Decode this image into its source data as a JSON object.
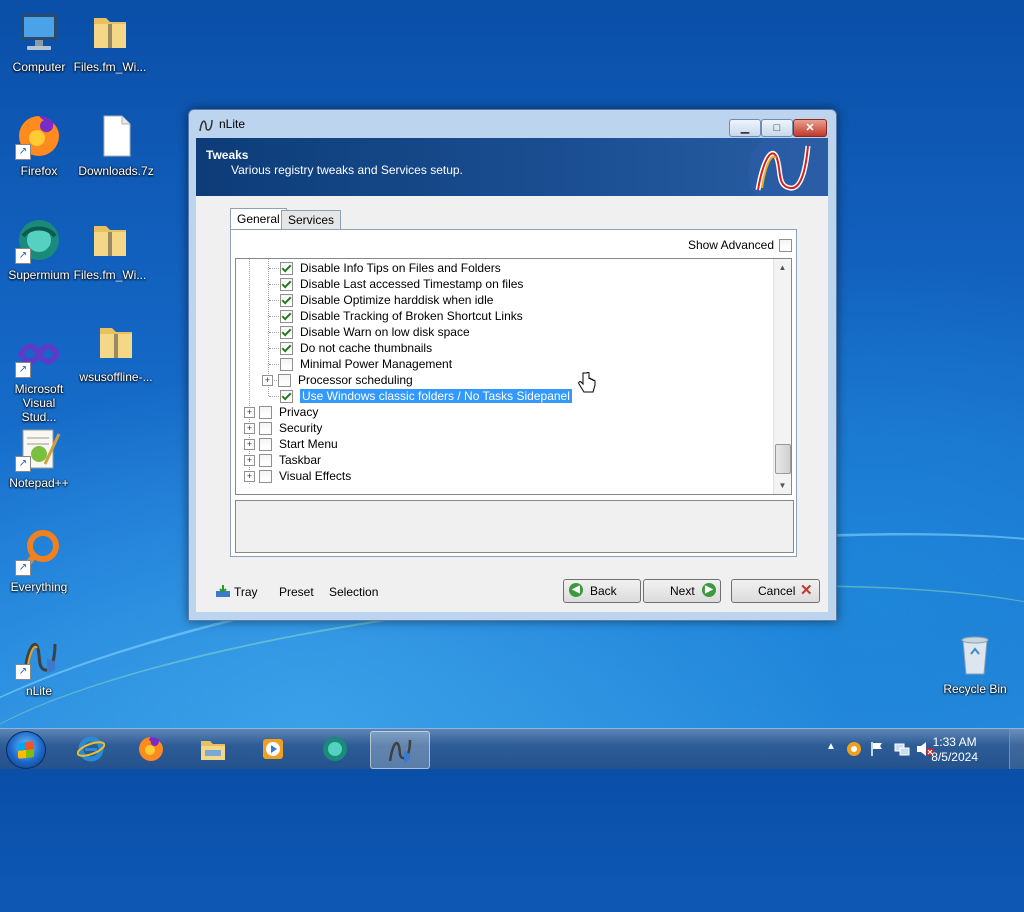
{
  "desktop": {
    "icons": [
      {
        "label": "Computer"
      },
      {
        "label": "Files.fm_Wi..."
      },
      {
        "label": "Firefox"
      },
      {
        "label": "Downloads.7z"
      },
      {
        "label": "Supermium"
      },
      {
        "label": "Files.fm_Wi..."
      },
      {
        "label": "Microsoft Visual Stud..."
      },
      {
        "label": "wsusoffline-..."
      },
      {
        "label": "Notepad++"
      },
      {
        "label": "Everything"
      },
      {
        "label": "nLite"
      },
      {
        "label": "Recycle Bin"
      }
    ]
  },
  "window": {
    "title": "nLite",
    "header": {
      "title": "Tweaks",
      "subtitle": "Various registry tweaks and Services setup."
    },
    "tabs": [
      {
        "label": "General",
        "active": true
      },
      {
        "label": "Services",
        "active": false
      }
    ],
    "show_advanced": {
      "label": "Show Advanced",
      "checked": false
    },
    "tree": {
      "child_items": [
        {
          "label": "Disable Info Tips on Files and Folders",
          "checked": true
        },
        {
          "label": "Disable Last accessed Timestamp on files",
          "checked": true
        },
        {
          "label": "Disable Optimize harddisk when idle",
          "checked": true
        },
        {
          "label": "Disable Tracking of Broken Shortcut Links",
          "checked": true
        },
        {
          "label": "Disable Warn on low disk space",
          "checked": true
        },
        {
          "label": "Do not cache thumbnails",
          "checked": true
        },
        {
          "label": "Minimal Power Management",
          "checked": false
        },
        {
          "label": "Processor scheduling",
          "checked": false,
          "expandable": true
        },
        {
          "label": "Use Windows classic folders / No Tasks Sidepanel",
          "checked": true,
          "selected": true
        }
      ],
      "top_items": [
        {
          "label": "Privacy",
          "checked": false
        },
        {
          "label": "Security",
          "checked": false
        },
        {
          "label": "Start Menu",
          "checked": false
        },
        {
          "label": "Taskbar",
          "checked": false
        },
        {
          "label": "Visual Effects",
          "checked": false
        }
      ]
    },
    "bottom": {
      "tray_label": "Tray",
      "preset_label": "Preset",
      "selection_label": "Selection",
      "back_label": "Back",
      "next_label": "Next",
      "cancel_label": "Cancel"
    }
  },
  "taskbar": {
    "apps": [
      {
        "icon": "internet-explorer-icon"
      },
      {
        "icon": "firefox-icon"
      },
      {
        "icon": "file-explorer-icon"
      },
      {
        "icon": "media-player-icon"
      },
      {
        "icon": "supermium-icon"
      },
      {
        "icon": "nlite-icon",
        "active": true
      }
    ],
    "clock": {
      "time": "1:33 AM",
      "date": "8/5/2024"
    }
  }
}
